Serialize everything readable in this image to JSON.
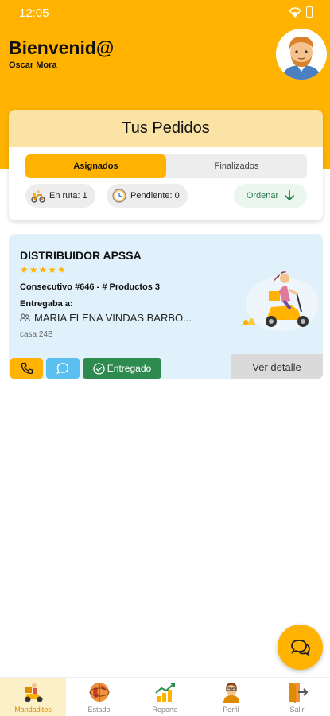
{
  "status_bar": {
    "time": "12:05",
    "icons": [
      "wifi-icon",
      "battery-icon"
    ]
  },
  "header": {
    "welcome": "Bienvenid@",
    "user_name": "Oscar Mora"
  },
  "orders": {
    "title": "Tus Pedidos",
    "tabs": [
      {
        "label": "Asignados",
        "active": true
      },
      {
        "label": "Finalizados",
        "active": false
      }
    ],
    "chips": [
      {
        "label": "En ruta: 1",
        "icon": "scooter-icon"
      },
      {
        "label": "Pendiente: 0",
        "icon": "clock-icon"
      }
    ],
    "sort_label": "Ordenar"
  },
  "order": {
    "distributor": "DISTRIBUIDOR APSSA",
    "stars": "★★★★★",
    "rating": 5,
    "consecutive": "Consecutivo #646 - # Productos 3",
    "deliver_label": "Entregaba a:",
    "recipient": "MARIA ELENA VINDAS BARBO...",
    "address": "casa 24B",
    "delivered_label": "Entregado",
    "detail_label": "Ver detalle"
  },
  "nav": [
    {
      "label": "Mandaditos",
      "icon": "scooter-icon",
      "active": true
    },
    {
      "label": "Estado",
      "icon": "globe-icon",
      "active": false
    },
    {
      "label": "Reporte",
      "icon": "chart-icon",
      "active": false
    },
    {
      "label": "Perfil",
      "icon": "profile-icon",
      "active": false
    },
    {
      "label": "Salir",
      "icon": "exit-icon",
      "active": false
    }
  ],
  "colors": {
    "primary": "#FFB300",
    "title_bar": "#FBE3A6",
    "card_bg": "#E1F1FB",
    "success": "#2E8B4F",
    "chat": "#5BC0F0"
  }
}
